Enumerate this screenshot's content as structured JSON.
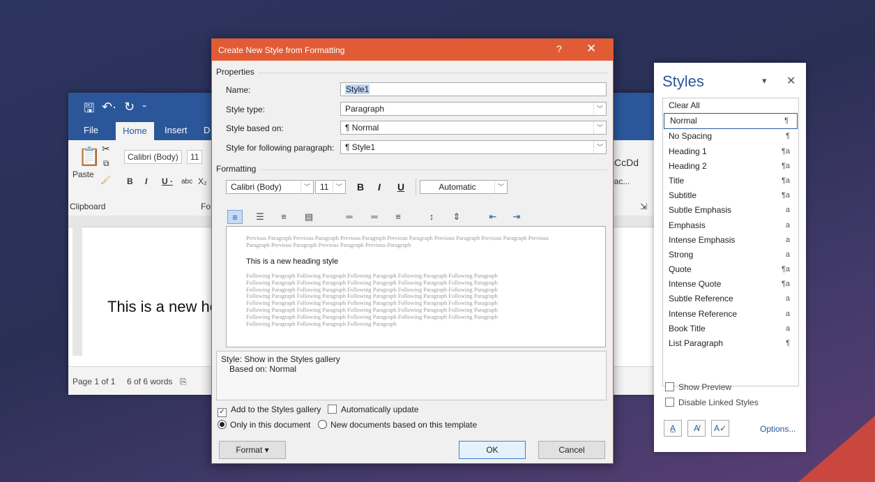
{
  "word": {
    "tabs": [
      "File",
      "Home",
      "Insert",
      "D"
    ],
    "font_name": "Calibri (Body)",
    "font_size": "11",
    "paste_label": "Paste",
    "clipboard_label": "Clipboard",
    "font_group_partial": "Fo",
    "gallery_partial_1": "cCcDd",
    "gallery_partial_2": "pac...",
    "doc_text": "This is a new he",
    "status": {
      "page": "Page 1 of 1",
      "words": "6 of 6 words"
    }
  },
  "dialog": {
    "title": "Create New Style from Formatting",
    "help": "?",
    "close": "✕",
    "properties_heading": "Properties",
    "name_label": "Name:",
    "name_value": "Style1",
    "type_label": "Style type:",
    "type_value": "Paragraph",
    "based_label": "Style based on:",
    "based_value": "¶ Normal",
    "following_label": "Style for following paragraph:",
    "following_value": "¶ Style1",
    "formatting_heading": "Formatting",
    "font_name": "Calibri (Body)",
    "font_size": "11",
    "bold": "B",
    "italic": "I",
    "underline": "U",
    "color": "Automatic",
    "preview": {
      "previous": "Previous Paragraph Previous Paragraph Previous Paragraph Previous Paragraph Previous Paragraph Previous Paragraph Previous Paragraph Previous Paragraph Previous Paragraph Previous Paragraph",
      "sample": "This is a new heading style",
      "following": [
        "Following Paragraph Following Paragraph Following Paragraph Following Paragraph Following Paragraph",
        "Following Paragraph Following Paragraph Following Paragraph Following Paragraph Following Paragraph",
        "Following Paragraph Following Paragraph Following Paragraph Following Paragraph Following Paragraph",
        "Following Paragraph Following Paragraph Following Paragraph Following Paragraph Following Paragraph",
        "Following Paragraph Following Paragraph Following Paragraph Following Paragraph Following Paragraph",
        "Following Paragraph Following Paragraph Following Paragraph Following Paragraph Following Paragraph",
        "Following Paragraph Following Paragraph Following Paragraph Following Paragraph Following Paragraph",
        "Following Paragraph Following Paragraph Following Paragraph"
      ]
    },
    "description_line1": "Style: Show in the Styles gallery",
    "description_line2": "Based on: Normal",
    "add_gallery_label": "Add to the Styles gallery",
    "add_gallery_checked": true,
    "auto_update_label": "Automatically update",
    "auto_update_checked": false,
    "only_doc_label": "Only in this document",
    "new_docs_label": "New documents based on this template",
    "format_button": "Format ▾",
    "ok_button": "OK",
    "cancel_button": "Cancel"
  },
  "styles_pane": {
    "title": "Styles",
    "dropdown": "▾",
    "close": "✕",
    "items": [
      {
        "label": "Clear All",
        "mark": ""
      },
      {
        "label": "Normal",
        "mark": "¶"
      },
      {
        "label": "No Spacing",
        "mark": "¶"
      },
      {
        "label": "Heading 1",
        "mark": "¶a"
      },
      {
        "label": "Heading 2",
        "mark": "¶a"
      },
      {
        "label": "Title",
        "mark": "¶a"
      },
      {
        "label": "Subtitle",
        "mark": "¶a"
      },
      {
        "label": "Subtle Emphasis",
        "mark": "a"
      },
      {
        "label": "Emphasis",
        "mark": "a"
      },
      {
        "label": "Intense Emphasis",
        "mark": "a"
      },
      {
        "label": "Strong",
        "mark": "a"
      },
      {
        "label": "Quote",
        "mark": "¶a"
      },
      {
        "label": "Intense Quote",
        "mark": "¶a"
      },
      {
        "label": "Subtle Reference",
        "mark": "a"
      },
      {
        "label": "Intense Reference",
        "mark": "a"
      },
      {
        "label": "Book Title",
        "mark": "a"
      },
      {
        "label": "List Paragraph",
        "mark": "¶"
      }
    ],
    "show_preview": "Show Preview",
    "disable_linked": "Disable Linked Styles",
    "options": "Options..."
  },
  "colors": {
    "word_blue": "#2b579a",
    "dialog_title": "#e15c35",
    "selection": "#bcd4f4"
  }
}
